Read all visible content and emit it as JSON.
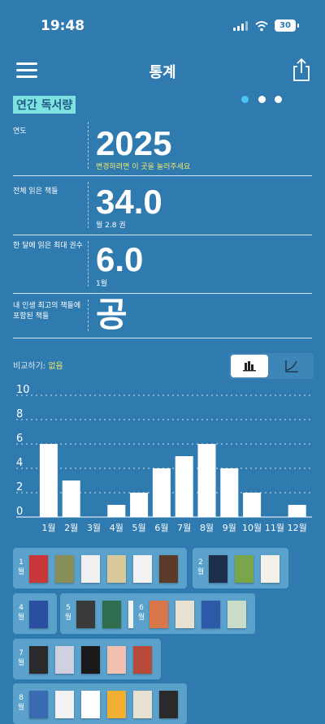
{
  "status": {
    "time": "19:48",
    "battery": "30"
  },
  "nav": {
    "title": "통계"
  },
  "section": {
    "title": "연간 독서량"
  },
  "stats": [
    {
      "label": "연도",
      "value": "2025",
      "sub": "변경하려면 이 곳을 눌러주세요",
      "sub_color": "#f1e86b"
    },
    {
      "label": "전체 읽은 책들",
      "value": "34.0",
      "sub": "월 2.8 권",
      "sub_color": "#ffffff"
    },
    {
      "label": "한 달에 읽은 최대 권수",
      "value": "6.0",
      "sub": "1월",
      "sub_color": "#ffffff"
    },
    {
      "label": "내 인생 최고의 책들에 포함된 책들",
      "value": "공",
      "sub": "",
      "sub_color": "#ffffff"
    }
  ],
  "compare": {
    "label": "비교하기:",
    "value": "없음"
  },
  "chart_data": {
    "type": "bar",
    "categories": [
      "1월",
      "2월",
      "3월",
      "4월",
      "5월",
      "6월",
      "7월",
      "8월",
      "9월",
      "10월",
      "11월",
      "12월"
    ],
    "values": [
      6,
      3,
      0,
      1,
      2,
      4,
      5,
      6,
      4,
      2,
      0,
      1
    ],
    "ylim": [
      0,
      10
    ],
    "yticks": [
      "0",
      "2",
      "4",
      "6",
      "8",
      "10"
    ],
    "grid": true,
    "bar_color": "#ffffff"
  },
  "month_groups": [
    {
      "label": "1월",
      "books": [
        "#c9363a",
        "#8a8f5a",
        "#f0f0f0",
        "#d8c89a",
        "#f2f2f2",
        "#5b3a2a"
      ]
    },
    {
      "label": "2월",
      "books": [
        "#1d2f4a",
        "#7aa64a",
        "#f4f2e8"
      ]
    },
    {
      "label": "4월",
      "books": [
        "#2a4fa0"
      ]
    },
    {
      "label": "5월",
      "books": [
        "#3a3a3a",
        "#2f6d4f",
        "#f2f2f2"
      ]
    },
    {
      "label": "6월",
      "books": [
        "#d9774a",
        "#e8e0d0",
        "#2c5aa8",
        "#c8dcc8"
      ]
    },
    {
      "label": "7월",
      "books": [
        "#2a2a2a",
        "#d0d0e0",
        "#1a1a1a",
        "#f1c0b0",
        "#b84a3a"
      ]
    },
    {
      "label": "8월",
      "books": [
        "#3a6ab0",
        "#f2f2f2",
        "#ffffff",
        "#f0b030",
        "#e8e0d0",
        "#2a2a2a"
      ]
    }
  ]
}
